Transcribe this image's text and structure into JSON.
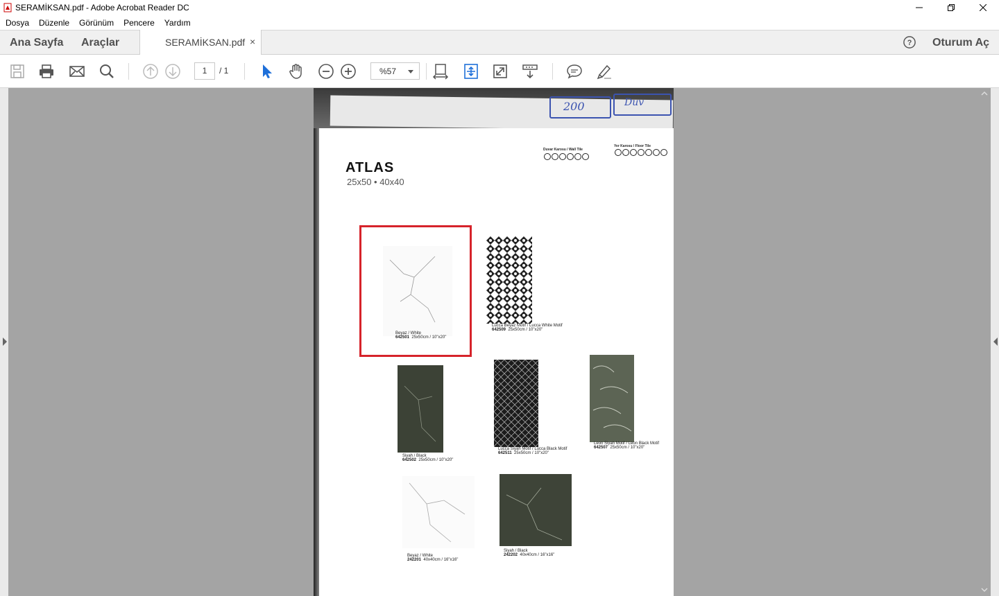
{
  "window": {
    "title": "SERAMİKSAN.pdf - Adobe Acrobat Reader DC"
  },
  "menu": [
    "Dosya",
    "Düzenle",
    "Görünüm",
    "Pencere",
    "Yardım"
  ],
  "tabs": {
    "home": "Ana Sayfa",
    "tools": "Araçlar",
    "document": "SERAMİKSAN.pdf",
    "close": "×",
    "signin": "Oturum Aç"
  },
  "toolbar": {
    "page_current": "1",
    "page_total": "/  1",
    "zoom": "%57"
  },
  "icons": {
    "save": "save-icon",
    "print": "print-icon",
    "mail": "mail-icon",
    "search": "search-icon",
    "prev": "page-up-icon",
    "next": "page-down-icon",
    "select": "cursor-icon",
    "hand": "hand-icon",
    "zoom_out": "zoom-out-icon",
    "zoom_in": "zoom-in-icon",
    "fit": "fit-page-icon",
    "fit_width": "fit-width-icon",
    "fullscreen": "fullscreen-icon",
    "scroll_mode": "scroll-mode-icon",
    "comment": "comment-icon",
    "highlight": "highlight-icon",
    "help": "help-icon"
  },
  "document": {
    "handwriting_1": "200",
    "handwriting_2": "Duv",
    "title": "ATLAS",
    "subtitle": "25x50 • 40x40",
    "legend_wall": "Duvar Karosu / Wall Tile",
    "legend_floor": "Yer Karosu / Floor Tile",
    "tiles": [
      {
        "name": "Beyaz / White",
        "code": "642501",
        "size": "25x50cm / 10\"x20\""
      },
      {
        "name": "Lucca Beyaz Motif / Lucca White Motif",
        "code": "642509",
        "size": "25x50cm / 10\"x20\""
      },
      {
        "name": "Siyah / Black",
        "code": "642502",
        "size": "25x50cm / 10\"x20\""
      },
      {
        "name": "Lucca Siyah Motif / Lucca Black Motif",
        "code": "642511",
        "size": "25x50cm / 10\"x20\""
      },
      {
        "name": "Leon Siyah Motif / Leon Black Motif",
        "code": "642507",
        "size": "25x50cm / 10\"x20\""
      },
      {
        "name": "Beyaz / White",
        "code": "242201",
        "size": "40x40cm / 16\"x16\""
      },
      {
        "name": "Siyah / Black",
        "code": "242202",
        "size": "40x40cm / 16\"x16\""
      }
    ]
  }
}
